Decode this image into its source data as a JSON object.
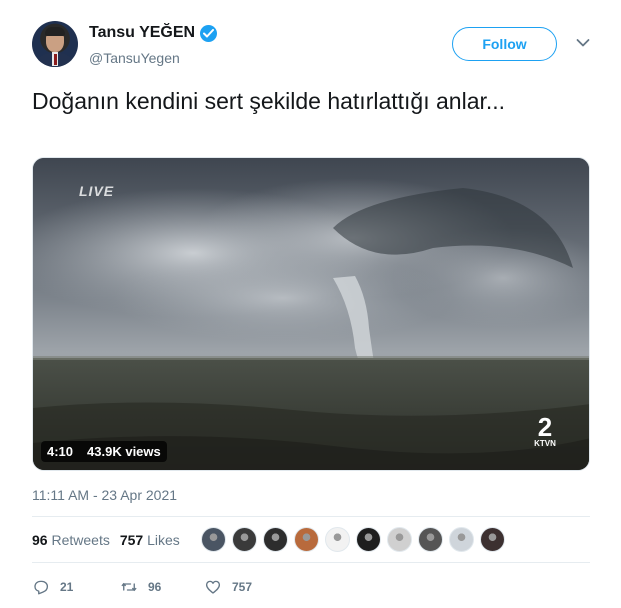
{
  "author": {
    "name": "Tansu YEĞEN",
    "handle": "@TansuYegen",
    "avatar_icon": "avatar",
    "verified_icon": "verified-badge-icon"
  },
  "header": {
    "follow_label": "Follow",
    "menu_icon": "chevron-down-icon"
  },
  "tweet": {
    "text": "Doğanın kendini sert şekilde hatırlattığı anlar...",
    "timestamp": "11:11 AM - 23 Apr 2021"
  },
  "media": {
    "overlay_text": "LIVE",
    "channel_logo_text": "2",
    "channel_logo_sub": "KTVN",
    "duration": "4:10",
    "views": "43.9K views"
  },
  "stats": {
    "retweets_count": "96",
    "retweets_label": "Retweets",
    "likes_count": "757",
    "likes_label": "Likes"
  },
  "likers": [
    {
      "color": "#4a5563"
    },
    {
      "color": "#3a3a3a"
    },
    {
      "color": "#2d2d2d"
    },
    {
      "color": "#b86a3c"
    },
    {
      "color": "#f2f2f2"
    },
    {
      "color": "#1e1e1e"
    },
    {
      "color": "#d0d0d0"
    },
    {
      "color": "#555555"
    },
    {
      "color": "#cfd5db"
    },
    {
      "color": "#3c3030"
    }
  ],
  "actions": {
    "reply_count": "21",
    "retweet_count": "96",
    "like_count": "757"
  },
  "colors": {
    "accent": "#1da1f2",
    "text_primary": "#14171a",
    "text_secondary": "#657786",
    "divider": "#e6ecf0"
  }
}
